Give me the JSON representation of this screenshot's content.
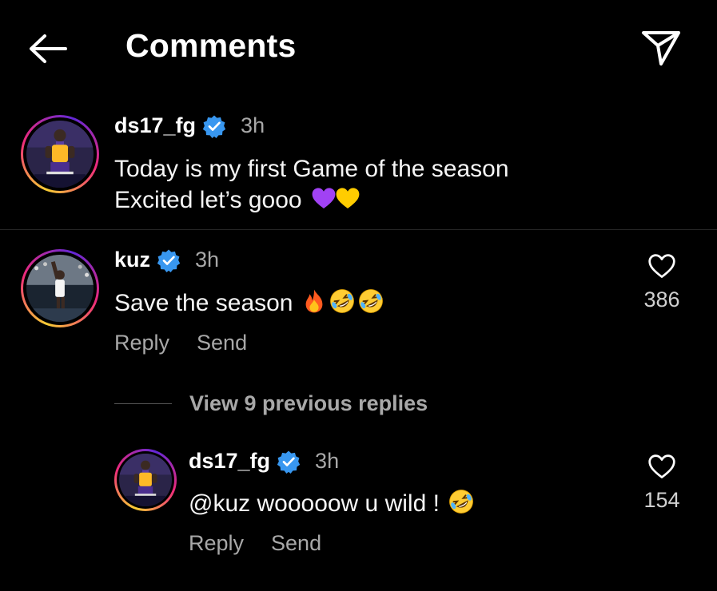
{
  "header": {
    "title": "Comments",
    "back_icon": "arrow-left-icon",
    "share_icon": "paper-plane-icon"
  },
  "caption": {
    "username": "ds17_fg",
    "verified": true,
    "time": "3h",
    "line1": "Today is my first Game of the season",
    "line2": "Excited let’s gooo",
    "emojis": [
      "purple-heart",
      "yellow-heart"
    ]
  },
  "comment": {
    "username": "kuz",
    "verified": true,
    "time": "3h",
    "text": "Save the season",
    "emojis": [
      "fire",
      "rolling-laughing",
      "rolling-laughing"
    ],
    "likes": "386",
    "reply_label": "Reply",
    "send_label": "Send"
  },
  "thread": {
    "view_replies": "View 9 previous replies"
  },
  "reply": {
    "username": "ds17_fg",
    "verified": true,
    "time": "3h",
    "text": "@kuz wooooow u wild !",
    "emojis": [
      "rolling-laughing"
    ],
    "likes": "154",
    "reply_label": "Reply",
    "send_label": "Send"
  },
  "colors": {
    "background": "#000000",
    "verified_badge": "#3897f0",
    "secondary_text": "#a8a8a8",
    "purple_heart": "#a142f4",
    "yellow_heart": "#ffcc00"
  }
}
